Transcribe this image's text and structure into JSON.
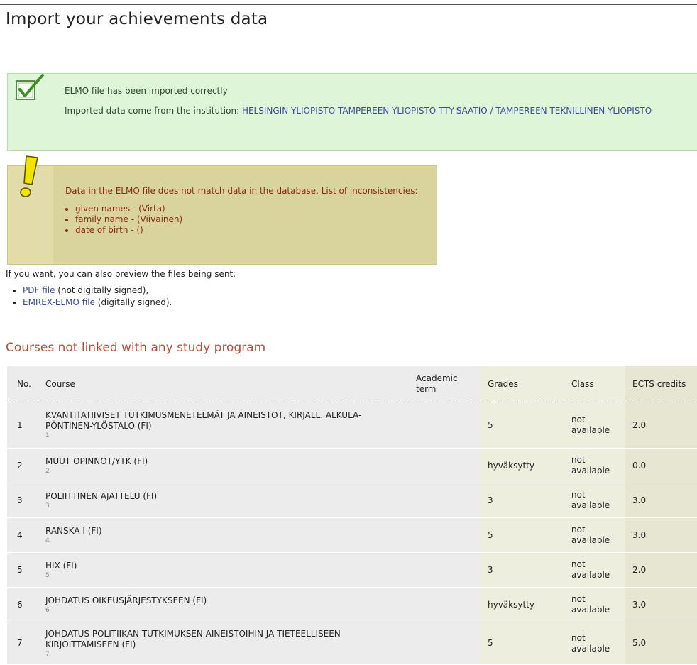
{
  "page": {
    "title": "Import your achievements data"
  },
  "success": {
    "icon": "checkmark-icon",
    "message": "ELMO file has been imported correctly",
    "institution_prefix": "Imported data come from the institution: ",
    "institution_name": "HELSINGIN YLIOPISTO TAMPEREEN YLIOPISTO TTY-SAATIO / TAMPEREEN TEKNILLINEN YLIOPISTO",
    "colors": {
      "background": "#dff5d8",
      "link": "#3a4aa0"
    }
  },
  "warning": {
    "icon": "exclamation-icon",
    "message": "Data in the ELMO file does not match data in the database. List of inconsistencies:",
    "items": [
      "given names - (Virta)",
      "family name - (Viivainen)",
      "date of birth - ()"
    ],
    "colors": {
      "background": "#d9d39e",
      "text": "#8a2a12"
    }
  },
  "preview": {
    "intro": "If you want, you can also preview the files being sent:",
    "files": [
      {
        "link": "PDF file",
        "note": " (not digitally signed),"
      },
      {
        "link": "EMREX-ELMO file",
        "note": " (digitally signed)."
      }
    ]
  },
  "courses": {
    "section_title": "Courses not linked with any study program",
    "headers": {
      "no": "No.",
      "course": "Course",
      "term": "Academic term",
      "grades": "Grades",
      "class": "Class",
      "ects": "ECTS credits"
    },
    "rows": [
      {
        "no": "1",
        "name": "KVANTITATIIVISET TUTKIMUSMENETELMÄT JA AINEISTOT, KIRJALL. ALKULA-PÖNTINEN-YLÖSTALO (FI)",
        "code": "1",
        "term": "",
        "grade": "5",
        "class": "not available",
        "ects": "2.0"
      },
      {
        "no": "2",
        "name": "MUUT OPINNOT/YTK (FI)",
        "code": "2",
        "term": "",
        "grade": "hyväksytty",
        "class": "not available",
        "ects": "0.0"
      },
      {
        "no": "3",
        "name": "POLIITTINEN AJATTELU (FI)",
        "code": "3",
        "term": "",
        "grade": "3",
        "class": "not available",
        "ects": "3.0"
      },
      {
        "no": "4",
        "name": "RANSKA I (FI)",
        "code": "4",
        "term": "",
        "grade": "5",
        "class": "not available",
        "ects": "3.0"
      },
      {
        "no": "5",
        "name": "HIX (FI)",
        "code": "5",
        "term": "",
        "grade": "3",
        "class": "not available",
        "ects": "2.0"
      },
      {
        "no": "6",
        "name": "JOHDATUS OIKEUSJÄRJESTYKSEEN (FI)",
        "code": "6",
        "term": "",
        "grade": "hyväksytty",
        "class": "not available",
        "ects": "3.0"
      },
      {
        "no": "7",
        "name": "JOHDATUS POLITIIKAN TUTKIMUKSEN AINEISTOIHIN JA TIETEELLISEEN KIRJOITTAMISEEN (FI)",
        "code": "7",
        "term": "",
        "grade": "5",
        "class": "not available",
        "ects": "5.0"
      }
    ]
  }
}
